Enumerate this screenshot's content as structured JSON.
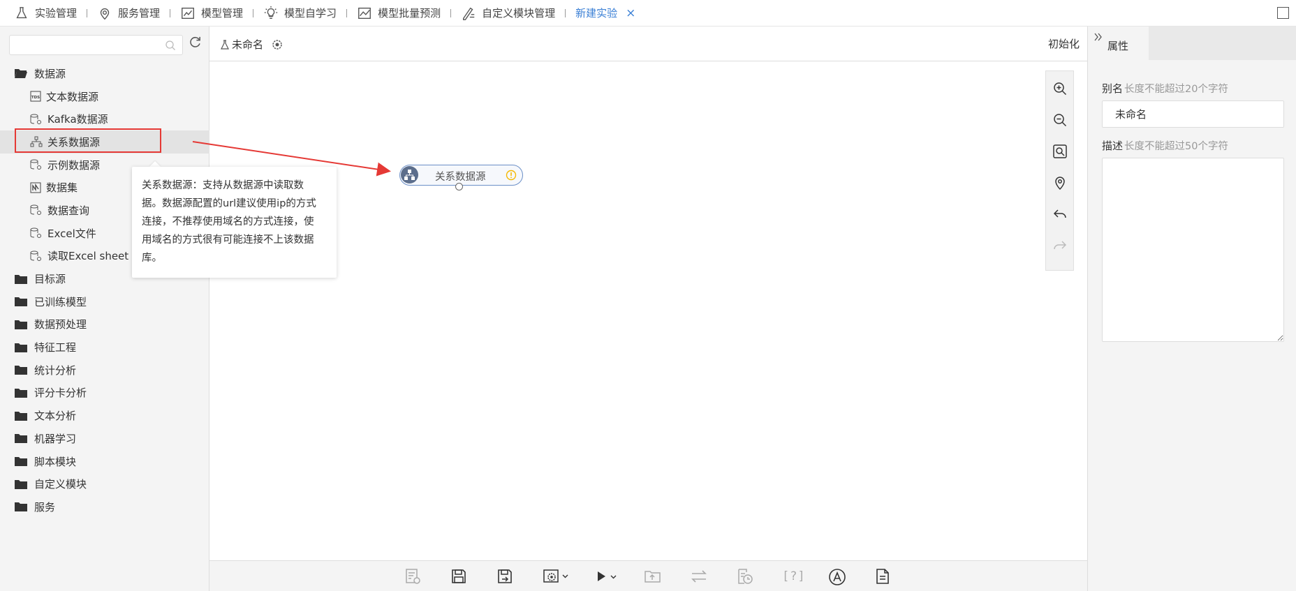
{
  "topnav": {
    "items": [
      {
        "label": "实验管理",
        "icon": "flask-icon"
      },
      {
        "label": "服务管理",
        "icon": "location-gear-icon"
      },
      {
        "label": "模型管理",
        "icon": "chart-icon"
      },
      {
        "label": "模型自学习",
        "icon": "lightbulb-icon"
      },
      {
        "label": "模型批量预测",
        "icon": "line-chart-icon"
      },
      {
        "label": "自定义模块管理",
        "icon": "pen-list-icon"
      }
    ],
    "active_tab": "新建实验",
    "close_glyph": "×"
  },
  "sidebar": {
    "search_placeholder": "",
    "tree": [
      {
        "label": "数据源",
        "children": [
          {
            "label": "文本数据源",
            "icon": "tds-icon"
          },
          {
            "label": "Kafka数据源",
            "icon": "db-gear-icon"
          },
          {
            "label": "关系数据源",
            "icon": "relation-icon",
            "selected": true
          },
          {
            "label": "示例数据源",
            "icon": "db-gear-icon"
          },
          {
            "label": "数据集",
            "icon": "dataset-icon"
          },
          {
            "label": "数据查询",
            "icon": "db-gear-icon"
          },
          {
            "label": "Excel文件",
            "icon": "db-gear-icon"
          },
          {
            "label": "读取Excel sheet",
            "icon": "db-gear-icon"
          }
        ]
      },
      {
        "label": "目标源"
      },
      {
        "label": "已训练模型"
      },
      {
        "label": "数据预处理"
      },
      {
        "label": "特征工程"
      },
      {
        "label": "统计分析"
      },
      {
        "label": "评分卡分析"
      },
      {
        "label": "文本分析"
      },
      {
        "label": "机器学习"
      },
      {
        "label": "脚本模块"
      },
      {
        "label": "自定义模块"
      },
      {
        "label": "服务"
      }
    ]
  },
  "tooltip": {
    "lines": [
      "关系数据源：支持从数据源中读取数",
      "据。数据源配置的url建议使用ip的方式",
      "连接，不推荐使用域名的方式连接，使",
      "用域名的方式很有可能连接不上该数据",
      "库。"
    ]
  },
  "canvas": {
    "experiment_name": "未命名",
    "init_label": "初始化",
    "node_label": "关系数据源",
    "zoom_tools": [
      "zoom-in-icon",
      "zoom-out-icon",
      "fit-view-icon",
      "locate-icon",
      "undo-icon",
      "redo-icon"
    ],
    "bottom_tools": [
      "run-log-icon",
      "save-icon",
      "save-as-icon",
      "settings-dropdown-icon",
      "run-dropdown-icon",
      "export-icon",
      "swap-icon",
      "schedule-icon",
      "help-icon",
      "auto-layout-icon",
      "document-icon"
    ],
    "help_glyph": "[?]"
  },
  "properties": {
    "tab_label": "属性",
    "alias_label": "别名",
    "alias_hint": "长度不能超过20个字符",
    "alias_value": "未命名",
    "desc_label": "描述",
    "desc_hint": "长度不能超过50个字符",
    "desc_value": ""
  },
  "colors": {
    "accent": "#3a7fd5",
    "highlight": "#e53935",
    "warning": "#f5b800",
    "node_border": "#6b8fc7"
  }
}
